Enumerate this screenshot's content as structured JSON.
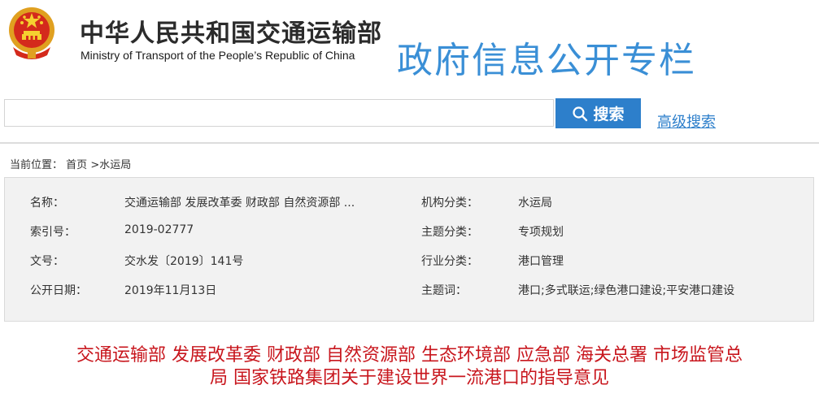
{
  "header": {
    "ministry_cn": "中华人民共和国交通运输部",
    "ministry_en": "Ministry of Transport of the People’s Republic of China",
    "column_title": "政府信息公开专栏",
    "emblem_icon": "national-emblem-icon"
  },
  "search": {
    "placeholder": "",
    "button_label": "搜索",
    "button_icon": "search-icon",
    "advanced_label": "高级搜索"
  },
  "breadcrumb": {
    "prefix": "当前位置：",
    "home": "首页",
    "separator": ">",
    "current": "水运局"
  },
  "meta": {
    "name_label": "名称：",
    "name_value": "交通运输部 发展改革委 财政部 自然资源部 ...",
    "index_label": "索引号：",
    "index_value": "2019-02777",
    "doc_label": "文号：",
    "doc_value": "交水发〔2019〕141号",
    "date_label": "公开日期：",
    "date_value": "2019年11月13日",
    "org_label": "机构分类：",
    "org_value": "水运局",
    "topic_label": "主题分类：",
    "topic_value": "专项规划",
    "industry_label": "行业分类：",
    "industry_value": "港口管理",
    "keywords_label": "主题词：",
    "keywords_value": "港口;多式联运;绿色港口建设;平安港口建设"
  },
  "article": {
    "title_line1": "交通运输部 发展改革委 财政部 自然资源部 生态环境部 应急部 海关总署 市场监管总",
    "title_line2": "局 国家铁路集团关于建设世界一流港口的指导意见"
  },
  "colors": {
    "accent_blue": "#2d7fcb",
    "title_blue": "#3a8fd6",
    "title_red": "#c8161d"
  }
}
